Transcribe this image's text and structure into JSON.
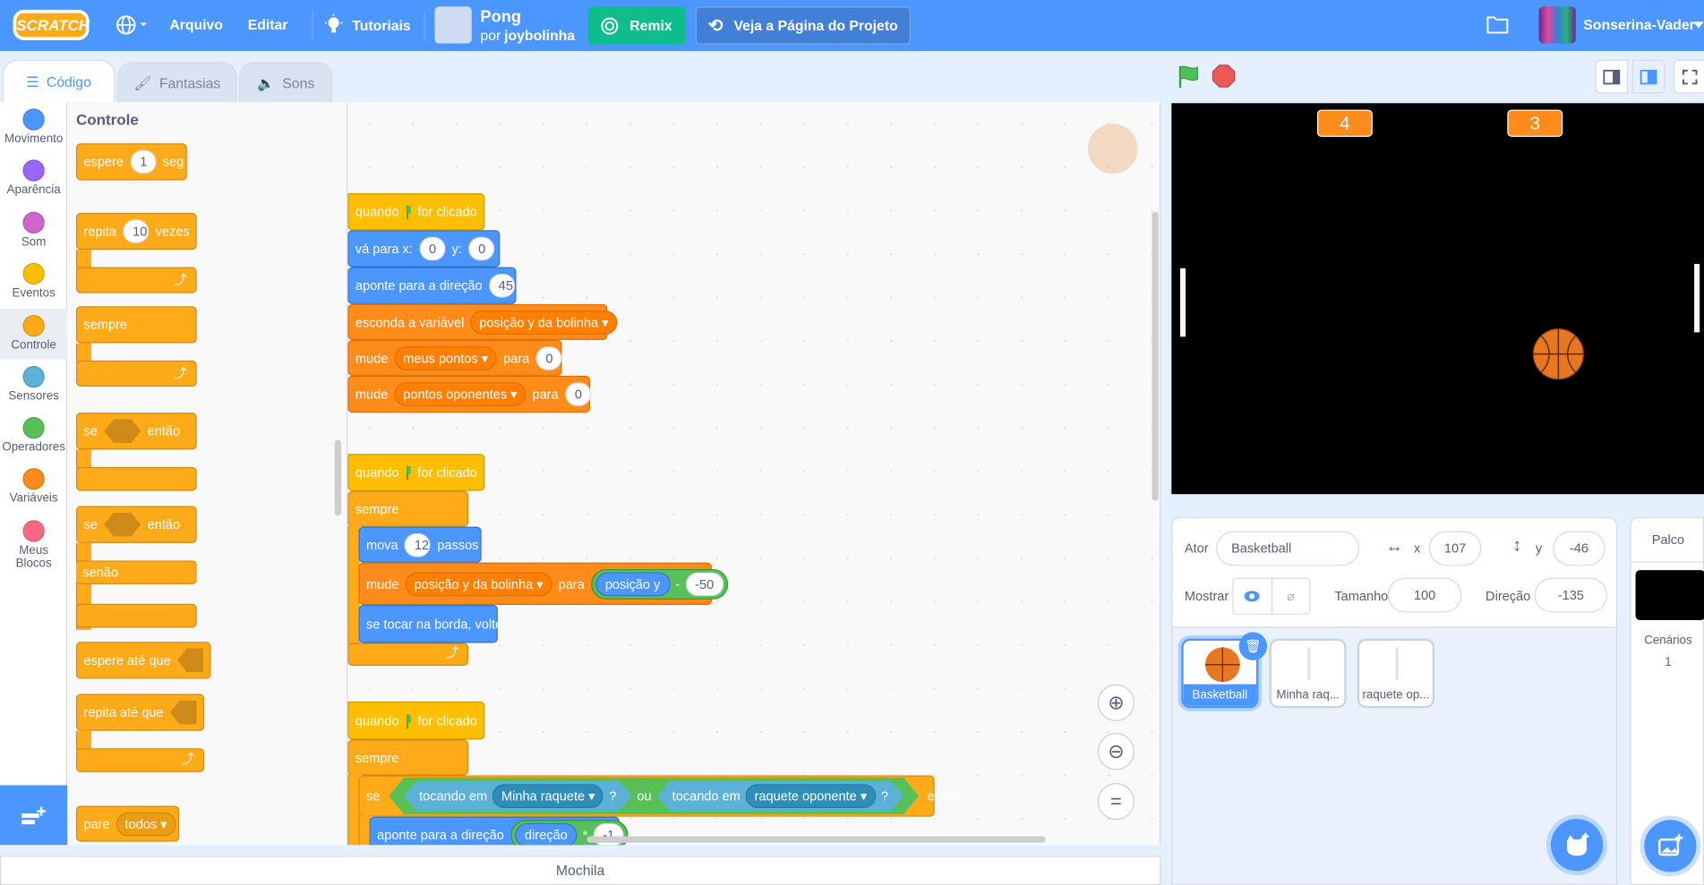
{
  "menu": {
    "logo": "Scratch",
    "arquivo": "Arquivo",
    "editar": "Editar",
    "tutoriais": "Tutoriais",
    "project_title": "Pong",
    "author_prefix": "por",
    "author": "joybolinha",
    "remix": "Remix",
    "see_page": "Veja a Página do Projeto",
    "username": "Sonserina-Vader"
  },
  "tabs": [
    "Código",
    "Fantasias",
    "Sons"
  ],
  "categories": [
    {
      "label": "Movimento",
      "color": "#4C97FF"
    },
    {
      "label": "Aparência",
      "color": "#9966FF"
    },
    {
      "label": "Som",
      "color": "#CF63CF"
    },
    {
      "label": "Eventos",
      "color": "#FFBF00"
    },
    {
      "label": "Controle",
      "color": "#FFAB19"
    },
    {
      "label": "Sensores",
      "color": "#5CB1D6"
    },
    {
      "label": "Operadores",
      "color": "#59C059"
    },
    {
      "label": "Variáveis",
      "color": "#FF8C1A"
    },
    {
      "label": "Meus Blocos",
      "color": "#FF6680"
    }
  ],
  "palette": {
    "heading": "Controle",
    "wait": {
      "t1": "espere",
      "v": "1",
      "t2": "seg"
    },
    "repeat": {
      "t1": "repita",
      "v": "10",
      "t2": "vezes"
    },
    "forever": "sempre",
    "if": {
      "t1": "se",
      "t2": "então"
    },
    "ifelse": {
      "t1": "se",
      "t2": "então",
      "t3": "senão"
    },
    "wait_until": "espere até que",
    "repeat_until": "repita até que",
    "stop": {
      "t1": "pare",
      "v": "todos"
    }
  },
  "scripts": {
    "s1": {
      "hat": {
        "t1": "quando",
        "t2": "for clicado"
      },
      "goto": {
        "t1": "vá para x:",
        "x": "0",
        "t2": "y:",
        "y": "0"
      },
      "point": {
        "t1": "aponte  para a direção",
        "v": "45"
      },
      "hide": {
        "t1": "esconda a variável",
        "v": "posição y da bolinha"
      },
      "set1": {
        "t1": "mude",
        "v": "meus pontos",
        "t2": "para",
        "n": "0"
      },
      "set2": {
        "t1": "mude",
        "v": "pontos oponentes",
        "t2": "para",
        "n": "0"
      }
    },
    "s2": {
      "hat": {
        "t1": "quando",
        "t2": "for clicado"
      },
      "forever": "sempre",
      "move": {
        "t1": "mova",
        "v": "12",
        "t2": "passos"
      },
      "set": {
        "t1": "mude",
        "v": "posição y da bolinha",
        "t2": "para",
        "r": "posição y",
        "op": "-",
        "n": "-50"
      },
      "bounce": "se tocar na borda, volte"
    },
    "s3": {
      "hat": {
        "t1": "quando",
        "t2": "for clicado"
      },
      "forever": "sempre",
      "if": {
        "t1": "se",
        "touch1": "tocando em",
        "v1": "Minha raquete",
        "q1": "?",
        "or": "ou",
        "touch2": "tocando em",
        "v2": "raquete oponente",
        "q2": "?",
        "then": "então"
      },
      "point": {
        "t1": "aponte  para a direção",
        "r": "direção",
        "op": "*",
        "n": "-1"
      }
    }
  },
  "stage": {
    "score_left": "4",
    "score_right": "3"
  },
  "sprite_info": {
    "ator_label": "Ator",
    "name": "Basketball",
    "x_label": "x",
    "x": "107",
    "y_label": "y",
    "y": "-46",
    "show_label": "Mostrar",
    "size_label": "Tamanho",
    "size": "100",
    "direction_label": "Direção",
    "direction": "-135"
  },
  "sprites": [
    "Basketball",
    "Minha raq...",
    "raquete op..."
  ],
  "stage_pane": {
    "title": "Palco",
    "backdrops_label": "Cenários",
    "backdrops_count": "1"
  },
  "backpack": "Mochila"
}
